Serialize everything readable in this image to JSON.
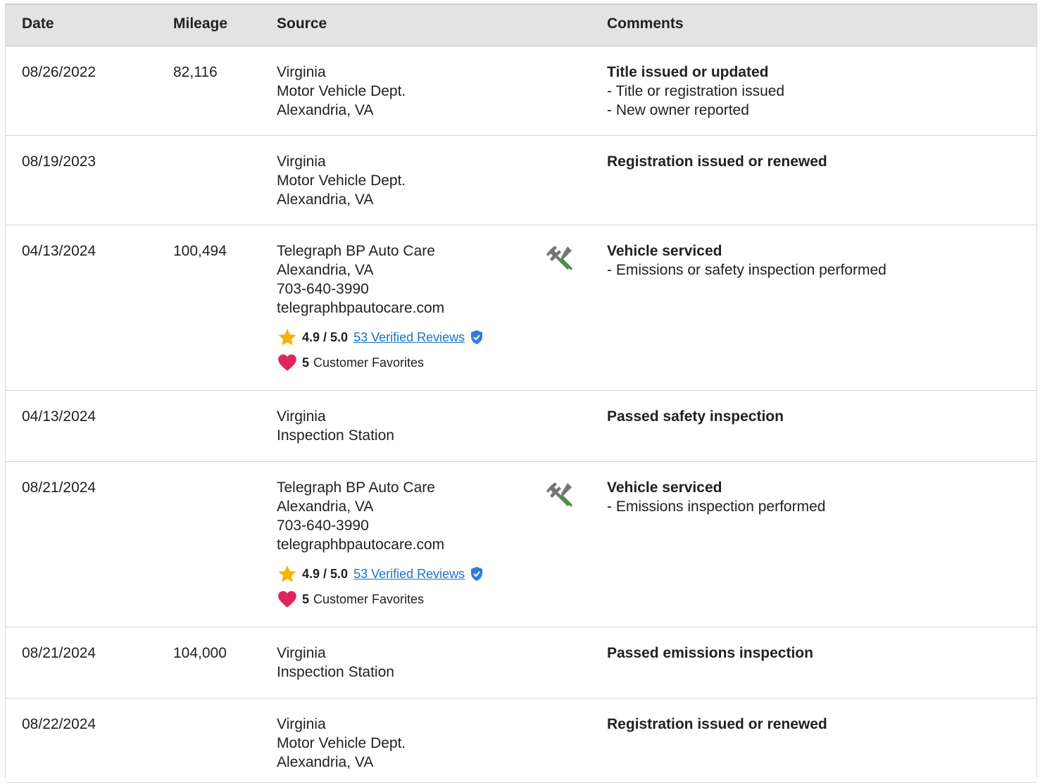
{
  "headers": {
    "date": "Date",
    "mileage": "Mileage",
    "source": "Source",
    "comments": "Comments"
  },
  "rows": [
    {
      "date": "08/26/2022",
      "mileage": "82,116",
      "source": [
        "Virginia",
        "Motor Vehicle Dept.",
        "Alexandria, VA"
      ],
      "comment_title": "Title issued or updated",
      "comment_items": [
        "- Title or registration issued",
        "- New owner reported"
      ]
    },
    {
      "date": "08/19/2023",
      "mileage": "",
      "source": [
        "Virginia",
        "Motor Vehicle Dept.",
        "Alexandria, VA"
      ],
      "comment_title": "Registration issued or renewed",
      "comment_items": []
    },
    {
      "date": "04/13/2024",
      "mileage": "100,494",
      "source": [
        "Telegraph BP Auto Care",
        "Alexandria, VA",
        "703-640-3990",
        "telegraphbpautocare.com"
      ],
      "service_icon": "wrench-screwdriver-icon",
      "rating": "4.9 / 5.0",
      "reviews": "53 Verified Reviews",
      "favorites_count": "5",
      "favorites_label": "Customer Favorites",
      "comment_title": "Vehicle serviced",
      "comment_items": [
        "- Emissions or safety inspection performed"
      ]
    },
    {
      "date": "04/13/2024",
      "mileage": "",
      "source": [
        "Virginia",
        "Inspection Station"
      ],
      "comment_title": "Passed safety inspection",
      "comment_items": []
    },
    {
      "date": "08/21/2024",
      "mileage": "",
      "source": [
        "Telegraph BP Auto Care",
        "Alexandria, VA",
        "703-640-3990",
        "telegraphbpautocare.com"
      ],
      "service_icon": "wrench-screwdriver-icon",
      "rating": "4.9 / 5.0",
      "reviews": "53 Verified Reviews",
      "favorites_count": "5",
      "favorites_label": "Customer Favorites",
      "comment_title": "Vehicle serviced",
      "comment_items": [
        "- Emissions inspection performed"
      ]
    },
    {
      "date": "08/21/2024",
      "mileage": "104,000",
      "source": [
        "Virginia",
        "Inspection Station"
      ],
      "comment_title": "Passed emissions inspection",
      "comment_items": []
    },
    {
      "date": "08/22/2024",
      "mileage": "",
      "source": [
        "Virginia",
        "Motor Vehicle Dept.",
        "Alexandria, VA"
      ],
      "comment_title": "Registration issued or renewed",
      "comment_items": []
    }
  ],
  "colors": {
    "star": "#f5b301",
    "heart": "#e0245e",
    "verified": "#2f7de1",
    "link": "#1a73c8",
    "wrench": "#757575",
    "screwdriver": "#3a9a3a"
  }
}
